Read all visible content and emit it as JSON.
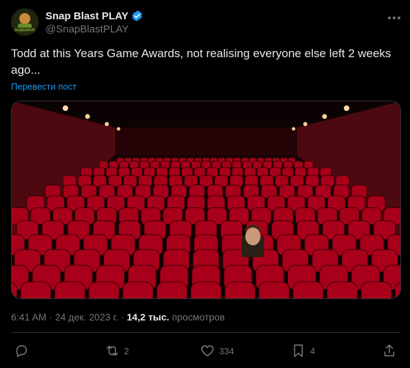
{
  "author": {
    "display_name": "Snap Blast PLAY",
    "handle": "@SnapBlastPLAY",
    "verified": true,
    "avatar_text": "SnapBlastPLAY"
  },
  "tweet": {
    "text": "Todd at this Years Game Awards, not realising everyone else left 2 weeks ago...",
    "translate_label": "Перевести пост"
  },
  "media": {
    "alt": "Empty cinema hall with red seats and one person seated"
  },
  "meta": {
    "time": "6:41 AM",
    "separator": "·",
    "date": "24 дек. 2023 г.",
    "views_count": "14,2 тыс.",
    "views_label": "просмотров"
  },
  "actions": {
    "reply_icon": "reply-icon",
    "retweet_count": "2",
    "like_count": "334",
    "bookmark_count": "4"
  },
  "colors": {
    "accent": "#1d9bf0",
    "muted": "#71767b",
    "text": "#e7e9ea",
    "seat": "#a8001a"
  }
}
